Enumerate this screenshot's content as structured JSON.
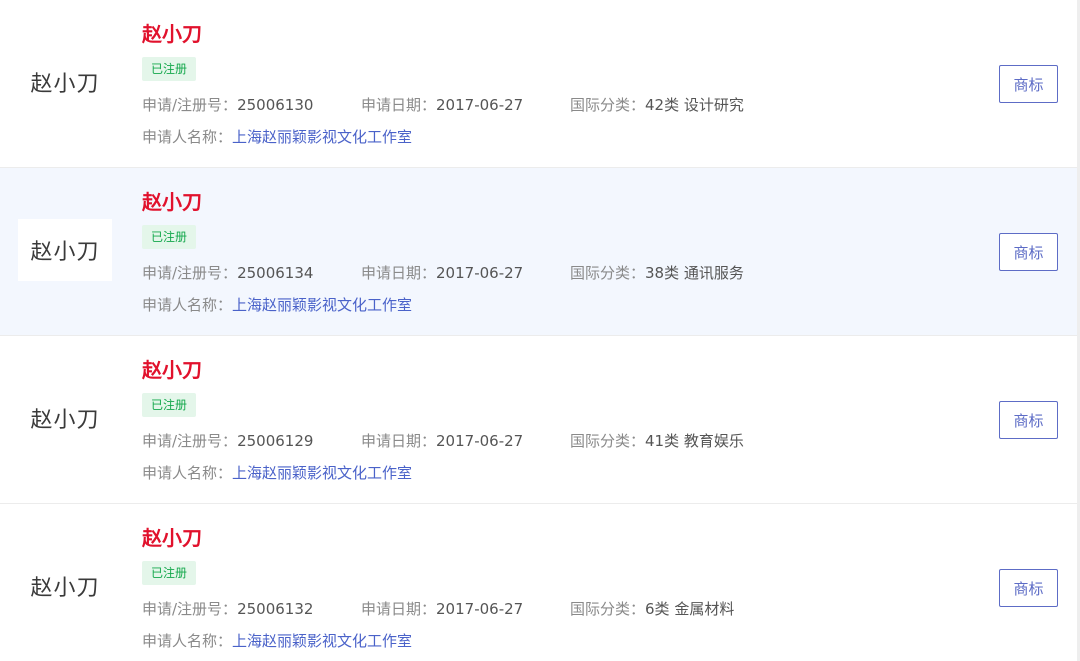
{
  "colors": {
    "title": "#e1112c",
    "badge_text": "#14a84c",
    "badge_bg": "#e4f6ea",
    "link": "#4a62c9",
    "button": "#5d6cc6",
    "highlight_row": "#f3f7fe"
  },
  "labels": {
    "reg_no": "申请/注册号：",
    "apply_date": "申请日期：",
    "intl_class": "国际分类：",
    "applicant": "申请人名称：",
    "button": "商标"
  },
  "items": [
    {
      "logo_text": "赵小刀",
      "name": "赵小刀",
      "status": "已注册",
      "reg_no": "25006130",
      "apply_date": "2017-06-27",
      "intl_class": "42类 设计研究",
      "applicant": "上海赵丽颖影视文化工作室"
    },
    {
      "logo_text": "赵小刀",
      "name": "赵小刀",
      "status": "已注册",
      "reg_no": "25006134",
      "apply_date": "2017-06-27",
      "intl_class": "38类 通讯服务",
      "applicant": "上海赵丽颖影视文化工作室"
    },
    {
      "logo_text": "赵小刀",
      "name": "赵小刀",
      "status": "已注册",
      "reg_no": "25006129",
      "apply_date": "2017-06-27",
      "intl_class": "41类 教育娱乐",
      "applicant": "上海赵丽颖影视文化工作室"
    },
    {
      "logo_text": "赵小刀",
      "name": "赵小刀",
      "status": "已注册",
      "reg_no": "25006132",
      "apply_date": "2017-06-27",
      "intl_class": "6类 金属材料",
      "applicant": "上海赵丽颖影视文化工作室"
    }
  ]
}
